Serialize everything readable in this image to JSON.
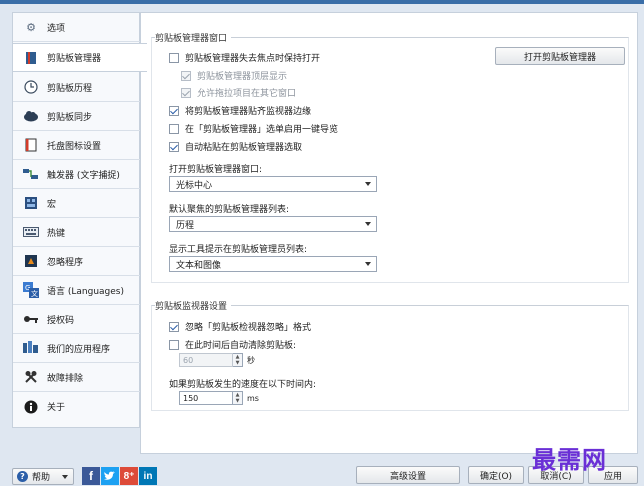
{
  "sidebar": {
    "items": [
      {
        "label": "选项",
        "icon": "gear-icon"
      },
      {
        "label": "剪贴板管理器",
        "icon": "clipboard-book-icon"
      },
      {
        "label": "剪贴板历程",
        "icon": "history-clock-icon"
      },
      {
        "label": "剪贴板同步",
        "icon": "sync-cloud-icon"
      },
      {
        "label": "托盘图标设置",
        "icon": "tray-icon"
      },
      {
        "label": "触发器 (文字捕捉)",
        "icon": "trigger-icon"
      },
      {
        "label": "宏",
        "icon": "macro-icon"
      },
      {
        "label": "热键",
        "icon": "hotkey-keyboard-icon"
      },
      {
        "label": "忽略程序",
        "icon": "ignore-program-icon"
      },
      {
        "label": "语言 (Languages)",
        "icon": "language-icon"
      },
      {
        "label": "授权码",
        "icon": "license-key-icon"
      },
      {
        "label": "我们的应用程序",
        "icon": "apps-icon"
      },
      {
        "label": "故障排除",
        "icon": "troubleshoot-tools-icon"
      },
      {
        "label": "关于",
        "icon": "info-icon"
      }
    ],
    "active_index": 1
  },
  "manager_group": {
    "title": "剪贴板管理器窗口",
    "open_button": "打开剪贴板管理器",
    "options": [
      {
        "label": "剪贴板管理器失去焦点时保持打开",
        "checked": false,
        "disabled": false
      },
      {
        "label": "剪贴板管理器顶层显示",
        "checked": true,
        "disabled": true
      },
      {
        "label": "允许拖拉项目在其它窗口",
        "checked": true,
        "disabled": true
      },
      {
        "label": "将剪贴板管理器贴齐监视器边缘",
        "checked": true,
        "disabled": false
      },
      {
        "label": "在「剪贴板管理器」选单启用一键导览",
        "checked": false,
        "disabled": false
      },
      {
        "label": "自动粘贴在剪贴板管理器选取",
        "checked": true,
        "disabled": false
      }
    ],
    "open_window_label": "打开剪贴板管理器窗口:",
    "open_window_value": "光标中心",
    "default_focus_label": "默认聚焦的剪贴板管理器列表:",
    "default_focus_value": "历程",
    "tooltip_label": "显示工具提示在剪贴板管理员列表:",
    "tooltip_value": "文本和图像"
  },
  "monitor_group": {
    "title": "剪贴板监视器设置",
    "ignore_format_label": "忽略「剪贴板检视器忽略」格式",
    "ignore_format_checked": true,
    "auto_clear_label": "在此时间后自动清除剪贴板:",
    "auto_clear_checked": false,
    "auto_clear_value": "60",
    "auto_clear_unit": "秒",
    "rate_label": "如果剪贴板发生的速度在以下时间内:",
    "rate_value": "150",
    "rate_unit": "ms"
  },
  "footer": {
    "help_label": "帮助",
    "advanced_button": "高级设置",
    "ok_button": "确定(O)",
    "cancel_button": "取消(C)",
    "apply_button": "应用"
  },
  "watermark": "最需网"
}
